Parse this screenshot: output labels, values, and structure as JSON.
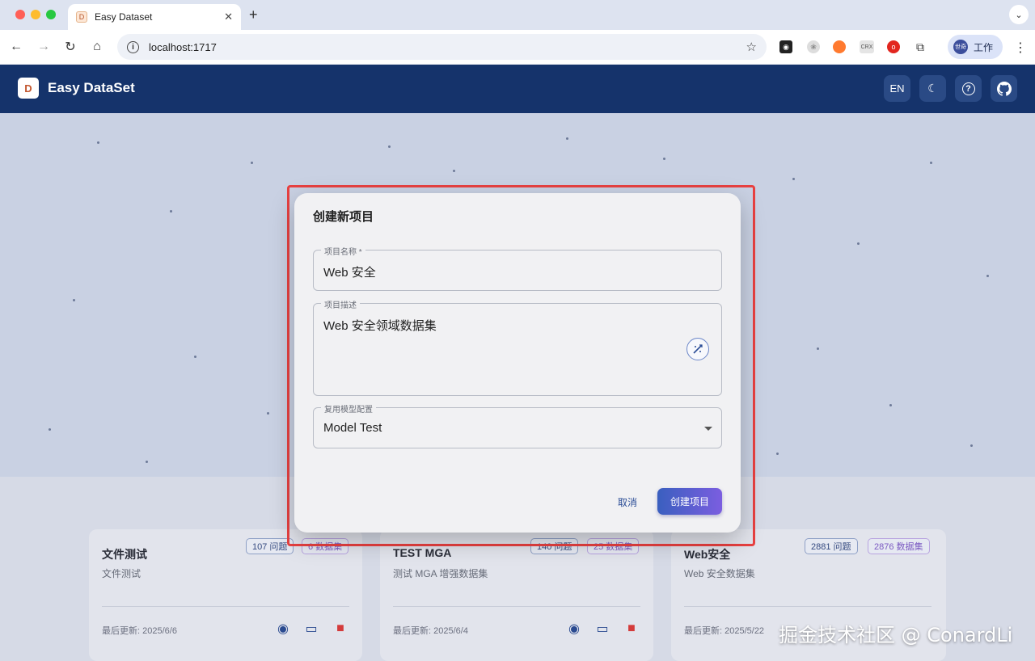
{
  "browser": {
    "tab_title": "Easy Dataset",
    "tab_favicon": "D",
    "url": "localhost:1717",
    "extensions": [
      "CRX"
    ],
    "profile_label": "工作",
    "profile_avatar": "世奇"
  },
  "app": {
    "brand": "Easy DataSet",
    "logo_glyph": "D",
    "language_button": "EN",
    "header_icons": [
      "moon-icon",
      "help-icon",
      "github-icon"
    ],
    "header_bg": "#15336b"
  },
  "dialog": {
    "title": "创建新项目",
    "name_label": "项目名称 *",
    "name_value": "Web 安全",
    "desc_label": "项目描述",
    "desc_value": "Web 安全领域数据集",
    "model_label": "复用模型配置",
    "model_value": "Model Test",
    "cancel_label": "取消",
    "create_label": "创建项目",
    "accent": "#3a5fbf",
    "highlight_color": "#e84141"
  },
  "projects": [
    {
      "name": "文件测试",
      "desc": "文件测试",
      "questions": "107 问题",
      "datasets": "6 数据集",
      "updated": "最后更新: 2025/6/6"
    },
    {
      "name": "TEST MGA",
      "desc": "测试 MGA 增强数据集",
      "questions": "140 问题",
      "datasets": "25 数据集",
      "updated": "最后更新: 2025/6/4"
    },
    {
      "name": "Web安全",
      "desc": "Web 安全数据集",
      "questions": "2881 问题",
      "datasets": "2876 数据集",
      "updated": "最后更新: 2025/5/22"
    }
  ],
  "watermark": "掘金技术社区 @ ConardLi"
}
